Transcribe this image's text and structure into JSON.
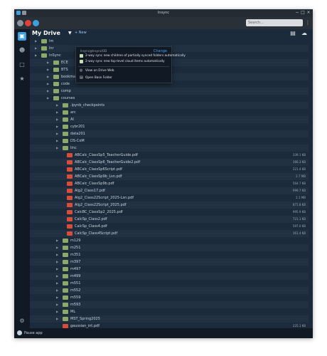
{
  "window": {
    "title": "Insync"
  },
  "toolbar": {
    "search_placeholder": "Search..."
  },
  "header": {
    "title": "My Drive",
    "new_label": "+ New"
  },
  "popup": {
    "email": "Insync@Insync/OD",
    "change_label": "Change",
    "options": [
      "2-way sync new children of partially synced folders automatically",
      "2-way sync new top-level cloud items automatically"
    ],
    "view_web": "View on Drive Web",
    "open_base": "Open Base Folder"
  },
  "rows": [
    {
      "name": "Im",
      "type": "folder",
      "level": 0,
      "size": ""
    },
    {
      "name": "lnr",
      "type": "folder",
      "level": 0,
      "size": ""
    },
    {
      "name": "InSync",
      "type": "folder",
      "level": 0,
      "size": ""
    },
    {
      "name": "ECE",
      "type": "folder",
      "level": 1,
      "size": ""
    },
    {
      "name": "BTS",
      "type": "folder",
      "level": 1,
      "size": ""
    },
    {
      "name": "bookmarks",
      "type": "folder",
      "level": 1,
      "size": ""
    },
    {
      "name": "code",
      "type": "folder",
      "level": 1,
      "size": ""
    },
    {
      "name": "comp",
      "type": "folder",
      "level": 1,
      "size": ""
    },
    {
      "name": "courses",
      "type": "folder",
      "level": 1,
      "size": ""
    },
    {
      "name": ".ipynb_checkpoints",
      "type": "folder",
      "level": 2,
      "size": ""
    },
    {
      "name": "arc",
      "type": "folder",
      "level": 2,
      "size": ""
    },
    {
      "name": "AI",
      "type": "folder",
      "level": 2,
      "size": ""
    },
    {
      "name": "cybr201",
      "type": "folder",
      "level": 2,
      "size": ""
    },
    {
      "name": "data201",
      "type": "folder",
      "level": 2,
      "size": ""
    },
    {
      "name": "DS-CoM",
      "type": "folder",
      "level": 2,
      "size": ""
    },
    {
      "name": "linc",
      "type": "folder",
      "level": 2,
      "size": ""
    },
    {
      "name": "ABCalc_ClassSp5_TeacherGuide.pdf",
      "type": "pdf",
      "level": 3,
      "size": "339.1 KB"
    },
    {
      "name": "ABCalc_ClassSp6_TeacherGuide2.pdf",
      "type": "pdf",
      "level": 3,
      "size": "366.3 KB"
    },
    {
      "name": "ABCalc_ClassSp6Script.pdf",
      "type": "pdf",
      "level": 3,
      "size": "221.4 KB"
    },
    {
      "name": "ABCalc_ClassSp9b_Lsn.pdf",
      "type": "pdf",
      "level": 3,
      "size": "2.7 MB"
    },
    {
      "name": "ABCalc_ClassSp9b.pdf",
      "type": "pdf",
      "level": 3,
      "size": "564.7 KB"
    },
    {
      "name": "Alg2_Class17.pdf",
      "type": "pdf",
      "level": 3,
      "size": "999.7 KB"
    },
    {
      "name": "Alg2_Class22Script_2025-Lsn.pdf",
      "type": "pdf",
      "level": 3,
      "size": "2.1 MB"
    },
    {
      "name": "Alg2_Class22Script_2025.pdf",
      "type": "pdf",
      "level": 3,
      "size": "871.8 KB"
    },
    {
      "name": "CalcBC_ClassSp2_2025.pdf",
      "type": "pdf",
      "level": 3,
      "size": "995.9 KB"
    },
    {
      "name": "CalcSp_Class2.pdf",
      "type": "pdf",
      "level": 3,
      "size": "721.1 KB"
    },
    {
      "name": "CalcSp_Class4.pdf",
      "type": "pdf",
      "level": 3,
      "size": "597.0 KB"
    },
    {
      "name": "CalcSp_Class4Script.pdf",
      "type": "pdf",
      "level": 3,
      "size": "361.4 KB"
    },
    {
      "name": "m129",
      "type": "folder",
      "level": 2,
      "size": ""
    },
    {
      "name": "m251",
      "type": "folder",
      "level": 2,
      "size": ""
    },
    {
      "name": "m351",
      "type": "folder",
      "level": 2,
      "size": ""
    },
    {
      "name": "m397",
      "type": "folder",
      "level": 2,
      "size": ""
    },
    {
      "name": "m497",
      "type": "folder",
      "level": 2,
      "size": ""
    },
    {
      "name": "m499",
      "type": "folder",
      "level": 2,
      "size": ""
    },
    {
      "name": "m551",
      "type": "folder",
      "level": 2,
      "size": ""
    },
    {
      "name": "m552",
      "type": "folder",
      "level": 2,
      "size": ""
    },
    {
      "name": "m559",
      "type": "folder",
      "level": 2,
      "size": ""
    },
    {
      "name": "m593",
      "type": "folder",
      "level": 2,
      "size": ""
    },
    {
      "name": "ML",
      "type": "folder",
      "level": 2,
      "size": ""
    },
    {
      "name": "MST_Spring2025",
      "type": "folder",
      "level": 2,
      "size": ""
    },
    {
      "name": "gaussian_int.pdf",
      "type": "pdf",
      "level": 2,
      "size": "225.1 KB"
    }
  ],
  "status": {
    "label": "Pause app"
  },
  "colors": {
    "folder": "#8da868",
    "pdf": "#d94c3a",
    "accent": "#4a9de8",
    "background": "#1c2b3b"
  },
  "icons": {
    "sidebar": [
      "drive-icon",
      "users-icon",
      "book-icon",
      "star-icon"
    ],
    "header": [
      "review-icon",
      "cloud-sync-icon"
    ]
  }
}
